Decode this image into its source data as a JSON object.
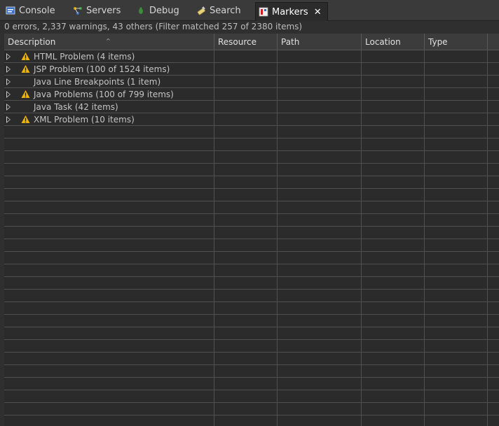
{
  "tabs": [
    {
      "label": "Console",
      "icon": "console-icon"
    },
    {
      "label": "Servers",
      "icon": "servers-icon"
    },
    {
      "label": "Debug",
      "icon": "debug-icon"
    },
    {
      "label": "Search",
      "icon": "search-icon"
    },
    {
      "label": "Markers",
      "icon": "markers-icon",
      "active": true
    }
  ],
  "status": "0 errors, 2,337 warnings, 43 others (Filter matched 257 of 2380 items)",
  "columns": [
    "Description",
    "Resource",
    "Path",
    "Location",
    "Type"
  ],
  "rows": [
    {
      "label": "HTML Problem (4 items)",
      "warning": true
    },
    {
      "label": "JSP Problem (100 of 1524 items)",
      "warning": true
    },
    {
      "label": "Java Line Breakpoints (1 item)",
      "warning": false
    },
    {
      "label": "Java Problems (100 of 799 items)",
      "warning": true
    },
    {
      "label": "Java Task (42 items)",
      "warning": false
    },
    {
      "label": "XML Problem (10 items)",
      "warning": true
    }
  ],
  "colors": {
    "background": "#2b2b2b",
    "grid": "#505050",
    "warning": "#f0b400"
  }
}
